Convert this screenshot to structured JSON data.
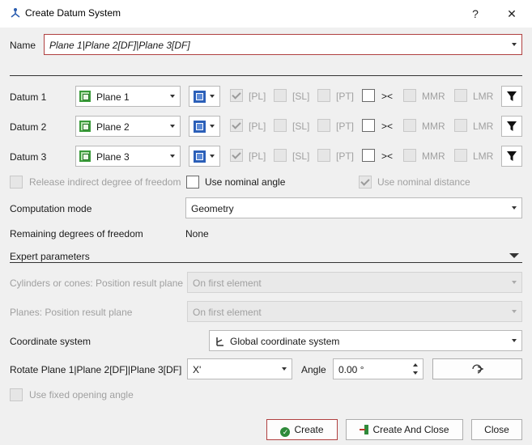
{
  "window": {
    "title": "Create Datum System",
    "help_label": "?",
    "close_label": "✕"
  },
  "name_label": "Name",
  "name_value": "Plane 1|Plane 2[DF]|Plane 3[DF]",
  "datums": [
    {
      "label": "Datum 1",
      "element": "Plane 1"
    },
    {
      "label": "Datum 2",
      "element": "Plane 2"
    },
    {
      "label": "Datum 3",
      "element": "Plane 3"
    }
  ],
  "flags": {
    "pl": "[PL]",
    "sl": "[SL]",
    "pt": "[PT]",
    "dir": "><",
    "mmr": "MMR",
    "lmr": "LMR"
  },
  "release_indirect_label": "Release indirect degree of freedom",
  "use_nominal_angle_label": "Use nominal angle",
  "use_nominal_distance_label": "Use nominal distance",
  "computation_mode_label": "Computation mode",
  "computation_mode_value": "Geometry",
  "remaining_dof_label": "Remaining degrees of freedom",
  "remaining_dof_value": "None",
  "expert_label": "Expert parameters",
  "cyl_label": "Cylinders or cones: Position result plane",
  "cyl_value": "On first element",
  "planes_label": "Planes: Position result plane",
  "planes_value": "On first element",
  "coord_label": "Coordinate system",
  "coord_value": "Global coordinate system",
  "rotate_label": "Rotate Plane 1|Plane 2[DF]|Plane 3[DF]",
  "rotate_axis": "X'",
  "angle_label": "Angle",
  "angle_value": "0.00 °",
  "fixed_angle_label": "Use fixed opening angle",
  "buttons": {
    "create": "Create",
    "create_close": "Create And Close",
    "close": "Close"
  }
}
